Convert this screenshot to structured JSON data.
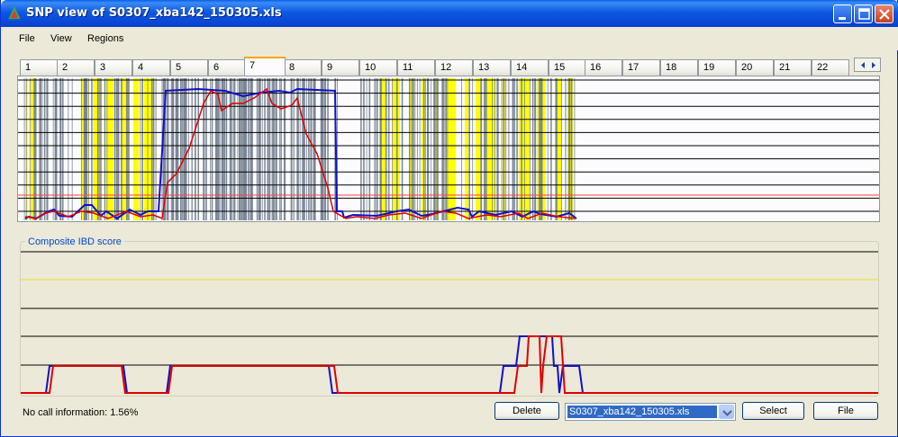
{
  "window": {
    "title": "SNP view of S0307_xba142_150305.xls"
  },
  "menu": {
    "items": [
      "File",
      "View",
      "Regions"
    ]
  },
  "tabs": {
    "labels": [
      "1",
      "2",
      "3",
      "4",
      "5",
      "6",
      "7",
      "8",
      "9",
      "10",
      "11",
      "12",
      "13",
      "14",
      "15",
      "16",
      "17",
      "18",
      "19",
      "20",
      "21",
      "22"
    ],
    "active_index": 6
  },
  "composite": {
    "title": "Composite IBD score"
  },
  "status": {
    "no_call": "No call information: 1.56%"
  },
  "buttons": {
    "delete": "Delete",
    "select": "Select",
    "file": "File"
  },
  "file_select": {
    "value": "S0307_xba142_150305.xls"
  },
  "colors": {
    "accent_title": "#0a49d6",
    "series_blue": "#1010c8",
    "series_red": "#e00000",
    "highlight_yellow": "#ffff00",
    "threshold_line": "#ff4040"
  },
  "icons": {
    "app": "snp-app-icon",
    "minimize": "minimize-icon",
    "maximize": "maximize-icon",
    "close": "close-icon",
    "scroll_left": "triangle-left-icon",
    "scroll_right": "triangle-right-icon",
    "dropdown": "chevron-down-icon"
  }
}
